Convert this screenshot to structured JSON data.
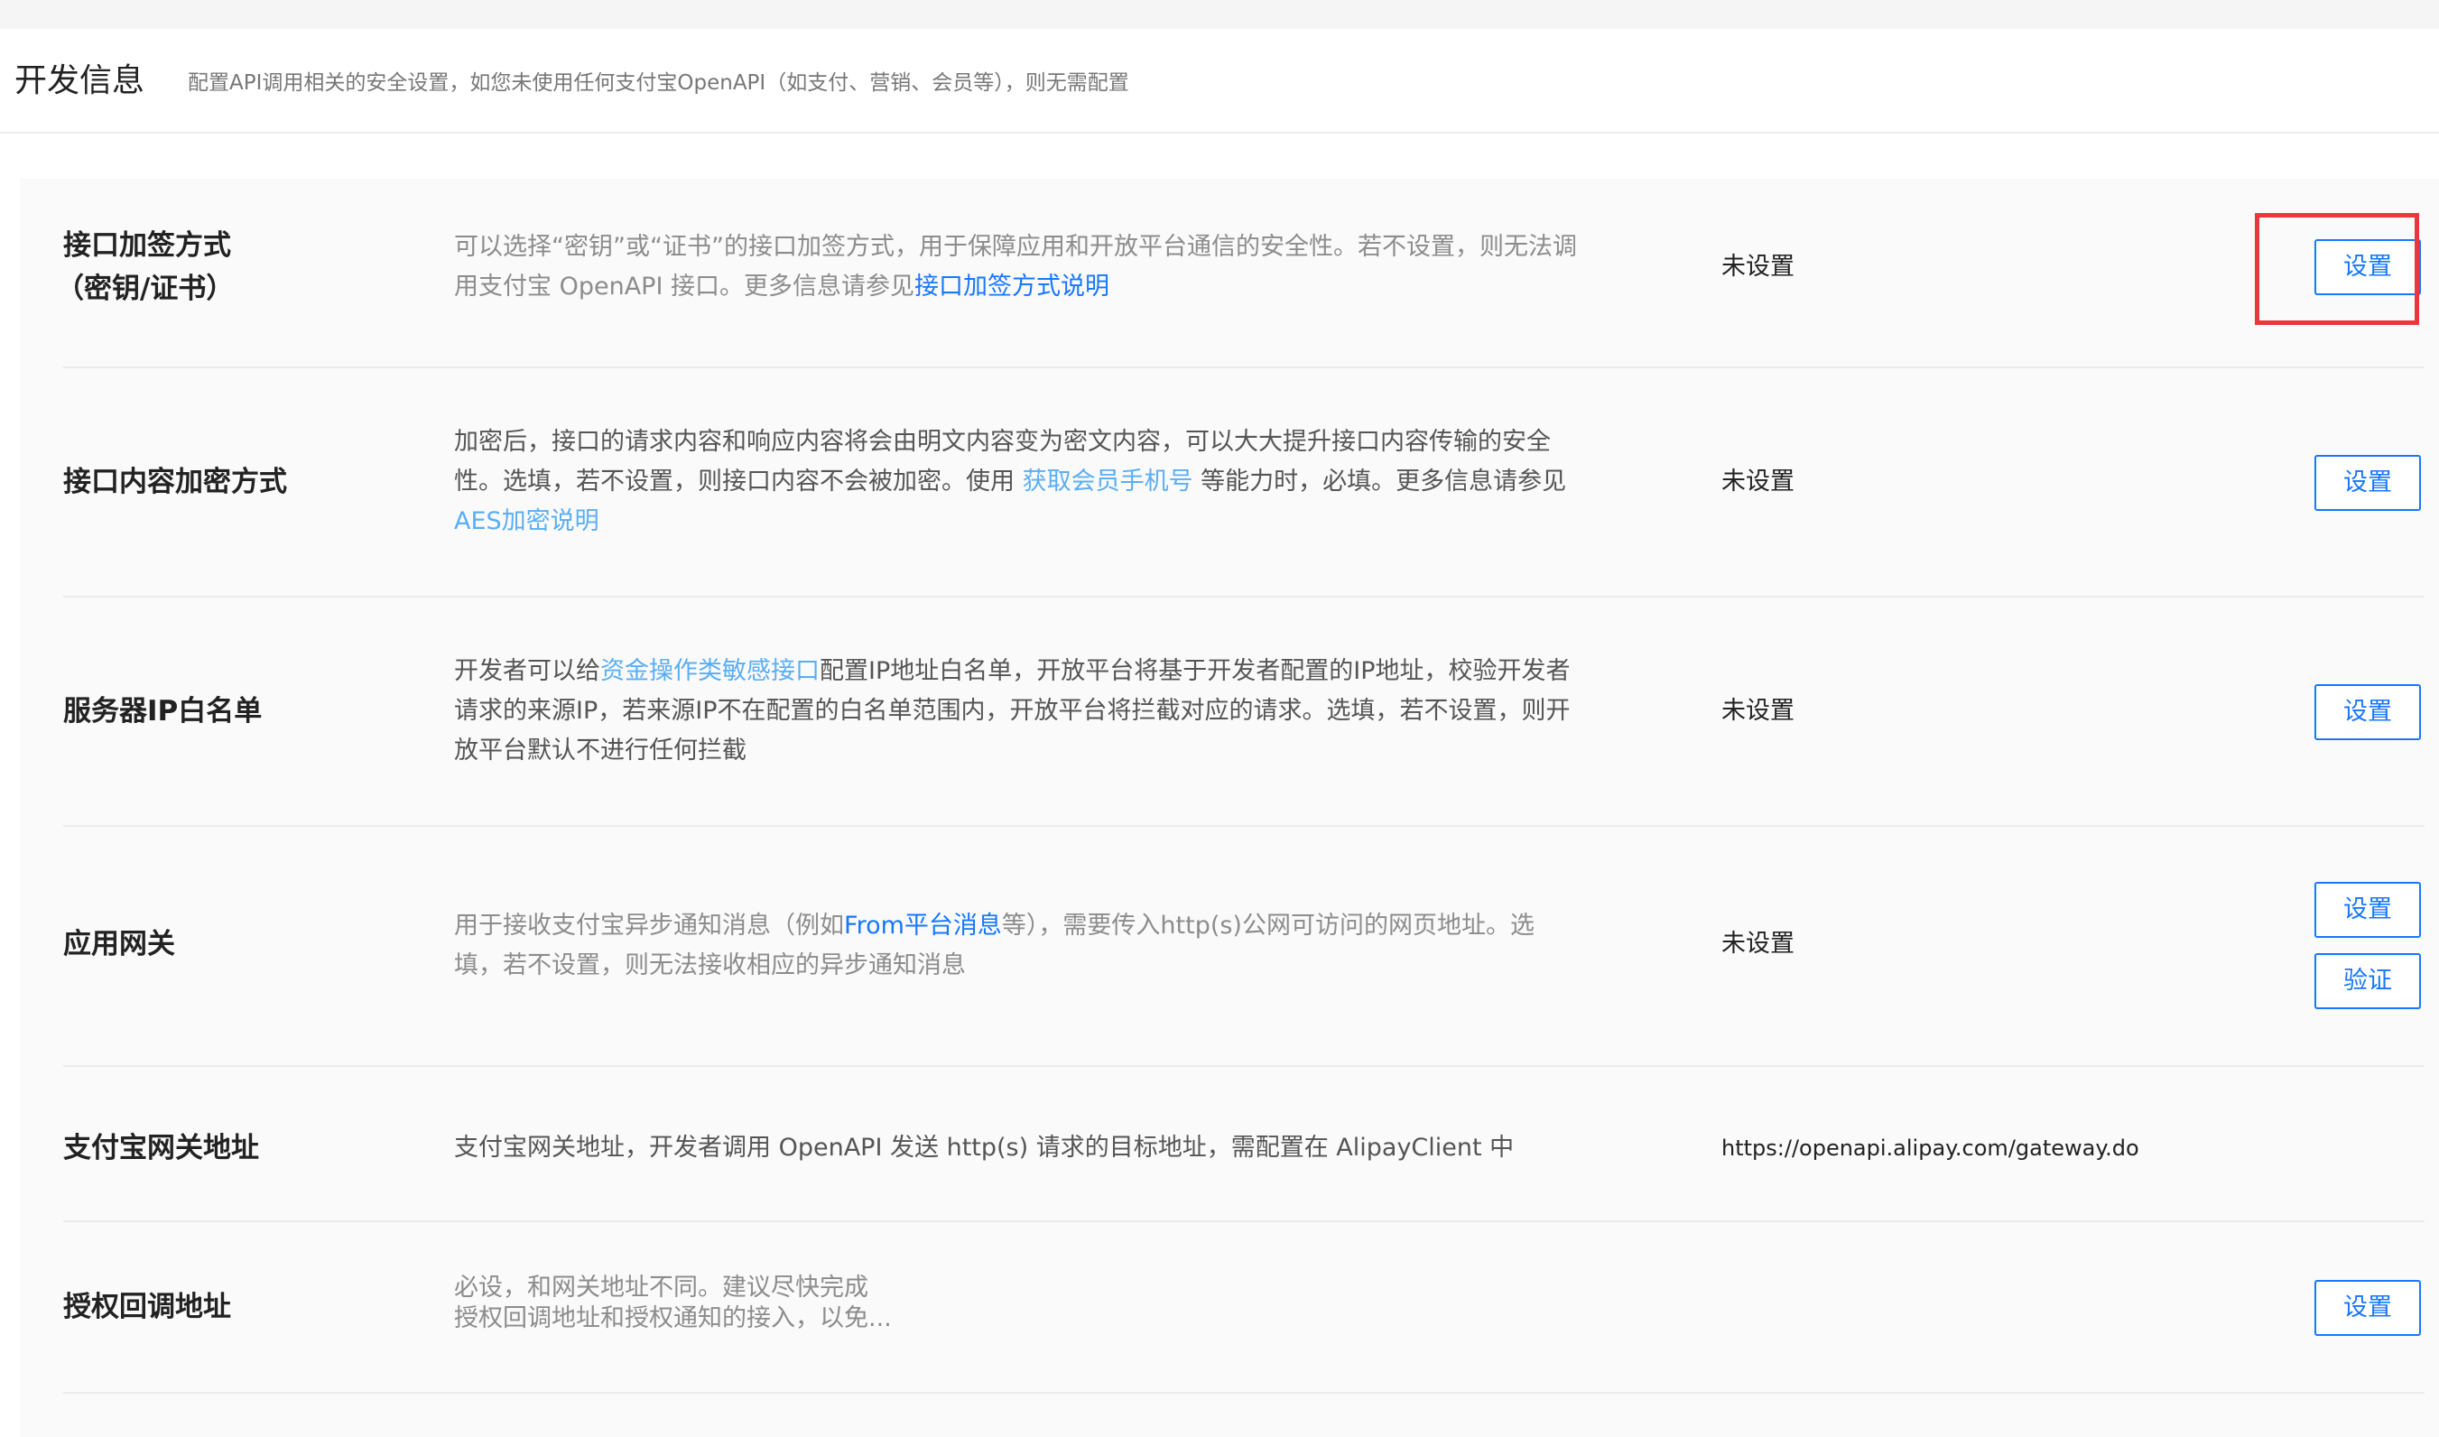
{
  "header": {
    "title": "开发信息",
    "description": "配置API调用相关的安全设置，如您未使用任何支付宝OpenAPI（如支付、营销、会员等），则无需配置"
  },
  "rows": [
    {
      "title_line1": "接口加签方式",
      "title_line2": "（密钥/证书）",
      "desc_line1": "可以选择“密钥”或“证书”的接口加签方式，用于保障应用和开放平台通信的安全性。若不设置，则无法调",
      "desc_line2_prefix": "用支付宝 OpenAPI 接口。更多信息请参见",
      "desc_link": "接口加签方式说明",
      "value": "未设置",
      "button": "设置"
    },
    {
      "title": "接口内容加密方式",
      "desc_line1": "加密后，接口的请求内容和响应内容将会由明文内容变为密文内容，可以大大提升接口内容传输的安全",
      "desc_line2_prefix": "性。选填，若不设置，则接口内容不会被加密。使用 ",
      "desc_link1": "获取会员手机号",
      "desc_line2_suffix": " 等能力时，必填。更多信息请参见",
      "desc_link2": "AES加密说明",
      "value": "未设置",
      "button": "设置"
    },
    {
      "title": "服务器IP白名单",
      "desc_prefix": "开发者可以给",
      "desc_link": "资金操作类敏感接口",
      "desc_line1_suffix": "配置IP地址白名单，开放平台将基于开发者配置的IP地址，校验开发者",
      "desc_line2": "请求的来源IP，若来源IP不在配置的白名单范围内，开放平台将拦截对应的请求。选填，若不设置，则开",
      "desc_line3": "放平台默认不进行任何拦截",
      "value": "未设置",
      "button": "设置"
    },
    {
      "title": "应用网关",
      "desc_prefix": "用于接收支付宝异步通知消息（例如",
      "desc_link": "From平台消息",
      "desc_line1_suffix": "等），需要传入http(s)公网可访问的网页地址。选",
      "desc_line2": "填，若不设置，则无法接收相应的异步通知消息",
      "value": "未设置",
      "button_set": "设置",
      "button_verify": "验证"
    },
    {
      "title": "支付宝网关地址",
      "desc": "支付宝网关地址，开发者调用 OpenAPI 发送 http(s) 请求的目标地址，需配置在 AlipayClient 中",
      "value": "https://openapi.alipay.com/gateway.do"
    },
    {
      "title": "授权回调地址",
      "desc_line1": "必设，和网关地址不同。建议尽快完成",
      "desc_line2": "授权回调地址和授权通知的接入，以免...",
      "button": "设置"
    }
  ],
  "colors": {
    "link": "#1677ff",
    "link_light": "#5aaef5",
    "highlight": "#e8383d",
    "panel_bg": "#fafafa"
  }
}
